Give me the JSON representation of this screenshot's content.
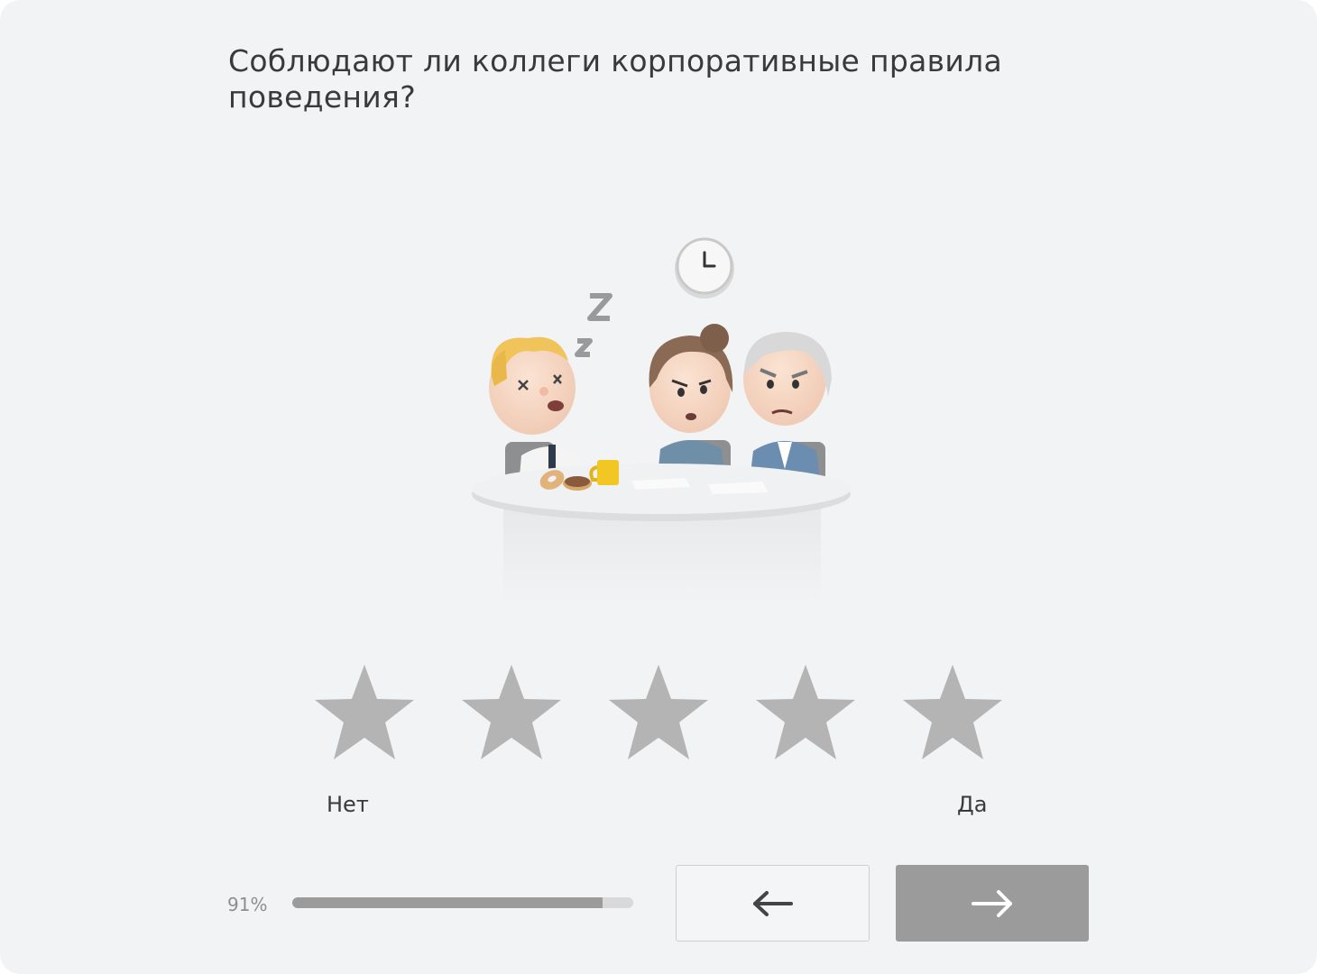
{
  "question": {
    "text": "Соблюдают ли коллеги корпоративные правила поведения?"
  },
  "illustration": {
    "icon": "meeting-illustration",
    "description_icons": [
      "clock-icon",
      "sleep-z-icon",
      "coffee-cup-icon",
      "donut-icon"
    ]
  },
  "rating": {
    "count": 5,
    "selected": 0,
    "star_color": "#b4b4b4",
    "min_label": "Нет",
    "max_label": "Да"
  },
  "progress": {
    "value_label": "91%",
    "fraction": 0.91
  },
  "navigation": {
    "back_icon": "arrow-left-icon",
    "next_icon": "arrow-right-icon"
  },
  "colors": {
    "background": "#f2f3f5",
    "text": "#3a3a3a",
    "accent_gray": "#9b9b9b"
  }
}
